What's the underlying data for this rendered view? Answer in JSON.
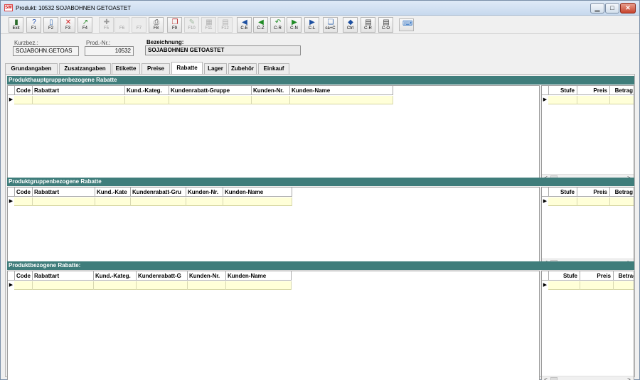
{
  "window": {
    "icon_text": "SW",
    "title": "Produkt: 10532 SOJABOHNEN GETOASTET",
    "min_glyph": "▁",
    "max_glyph": "□",
    "close_glyph": "✕"
  },
  "toolbar": [
    {
      "label": "Exit",
      "icon": "exit-icon",
      "glyph": "▮",
      "color": "#2a6b2a",
      "enabled": true
    },
    {
      "label": "F1",
      "icon": "help-icon",
      "glyph": "?",
      "color": "#1f4fb0",
      "enabled": true
    },
    {
      "label": "F2",
      "icon": "new-document-icon",
      "glyph": "▯",
      "color": "#3c6fb4",
      "enabled": true
    },
    {
      "label": "F3",
      "icon": "delete-icon",
      "glyph": "✕",
      "color": "#d21a1a",
      "enabled": true
    },
    {
      "label": "F4",
      "icon": "edit-icon",
      "glyph": "↗",
      "color": "#2a8a2a",
      "enabled": true
    },
    {
      "label": "F5",
      "icon": "tool-icon",
      "glyph": "✚",
      "color": "#9a9a9a",
      "enabled": false
    },
    {
      "label": "F6",
      "icon": "blank-icon",
      "glyph": "",
      "color": "#bcbcbc",
      "enabled": false
    },
    {
      "label": "F7",
      "icon": "blank-icon",
      "glyph": "",
      "color": "#bcbcbc",
      "enabled": false
    },
    {
      "label": "F8",
      "icon": "print-icon",
      "glyph": "⎙",
      "color": "#4a4a4a",
      "enabled": true
    },
    {
      "label": "F9",
      "icon": "copy-icon",
      "glyph": "❐",
      "color": "#b41e1e",
      "enabled": true
    },
    {
      "label": "F10",
      "icon": "disabled-tool-icon",
      "glyph": "✎",
      "color": "#9fb99f",
      "enabled": false
    },
    {
      "label": "F11",
      "icon": "disabled-calc-icon",
      "glyph": "▦",
      "color": "#b0b0b0",
      "enabled": false
    },
    {
      "label": "F12",
      "icon": "disabled-list-icon",
      "glyph": "▤",
      "color": "#b0b0b0",
      "enabled": false
    },
    {
      "label": "C-E",
      "icon": "first-record-icon",
      "glyph": "◀",
      "color": "#1c4fa0",
      "enabled": true
    },
    {
      "label": "C-Z",
      "icon": "previous-record-icon",
      "glyph": "◀",
      "color": "#1f8a24",
      "enabled": true
    },
    {
      "label": "C-R",
      "icon": "reset-icon",
      "glyph": "↶",
      "color": "#1f8a24",
      "enabled": true
    },
    {
      "label": "C-N",
      "icon": "next-record-icon",
      "glyph": "▶",
      "color": "#1f8a24",
      "enabled": true
    },
    {
      "label": "C-L",
      "icon": "last-record-icon",
      "glyph": "▶",
      "color": "#1c4fa0",
      "enabled": true
    },
    {
      "label": "ca+C",
      "icon": "duplicate-icon",
      "glyph": "❏",
      "color": "#2a5fa8",
      "enabled": true
    },
    {
      "label": "Ctrl",
      "icon": "control-icon",
      "glyph": "◆",
      "color": "#1c4fa0",
      "enabled": true
    },
    {
      "label": "C-R",
      "icon": "report-icon",
      "glyph": "▤",
      "color": "#3a3a3a",
      "enabled": true
    },
    {
      "label": "C-O",
      "icon": "open-icon",
      "glyph": "▤",
      "color": "#3a3a3a",
      "enabled": true
    },
    {
      "label": "",
      "icon": "keyboard-icon",
      "glyph": "⌨",
      "color": "#2a6fc4",
      "enabled": true
    }
  ],
  "header": {
    "kurzbez_label": "Kurzbez.:",
    "kurzbez_value": "SOJABOHN.GETOAS",
    "prodnr_label": "Prod.-Nr.:",
    "prodnr_value": "10532",
    "bezeichnung_label": "Bezeichnung:",
    "bezeichnung_value": "SOJABOHNEN GETOASTET"
  },
  "tabs": [
    {
      "label": "Grundangaben",
      "active": false
    },
    {
      "label": "Zusatzangaben",
      "active": false
    },
    {
      "label": "Etikette",
      "active": false
    },
    {
      "label": "Preise",
      "active": false
    },
    {
      "label": "Rabatte",
      "active": true
    },
    {
      "label": "Lager",
      "active": false
    },
    {
      "label": "Zubehör",
      "active": false
    },
    {
      "label": "Einkauf",
      "active": false
    }
  ],
  "sections": [
    {
      "title": "Produkthauptgruppenbezogene Rabatte",
      "left_columns": [
        "Code",
        "Rabattart",
        "Kund.-Kateg.",
        "Kundenrabatt-Gruppe",
        "Kunden-Nr.",
        "Kunden-Name"
      ],
      "right_columns": [
        "Stufe",
        "Preis",
        "Betrag"
      ]
    },
    {
      "title": "Produktgruppenbezogene Rabatte",
      "left_columns": [
        "Code",
        "Rabattart",
        "Kund.-Kate",
        "Kundenrabatt-Gru",
        "Kunden-Nr.",
        "Kunden-Name"
      ],
      "right_columns": [
        "Stufe",
        "Preis",
        "Betrag"
      ]
    },
    {
      "title": "Produktbezogene Rabatte:",
      "left_columns": [
        "Code",
        "Rabattart",
        "Kund.-Kateg.",
        "Kundenrabatt-G",
        "Kunden-Nr.",
        "Kunden-Name"
      ],
      "right_columns": [
        "Stufe",
        "Preis",
        "Betrag"
      ]
    }
  ],
  "row_indicator": "▶",
  "scroll_left": "<",
  "scroll_right": ">"
}
